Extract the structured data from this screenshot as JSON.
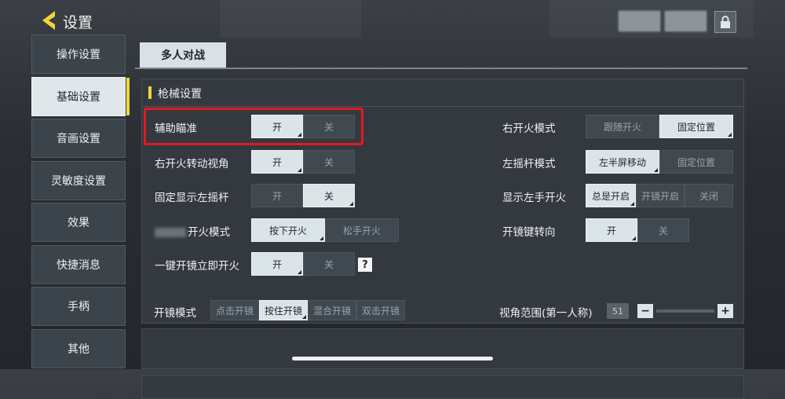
{
  "header": {
    "title": "设置"
  },
  "sidebar": {
    "items": [
      {
        "label": "操作设置"
      },
      {
        "label": "基础设置"
      },
      {
        "label": "音画设置"
      },
      {
        "label": "灵敏度设置"
      },
      {
        "label": "效果"
      },
      {
        "label": "快捷消息"
      },
      {
        "label": "手柄"
      },
      {
        "label": "其他"
      }
    ],
    "active_index": 1
  },
  "tabs": [
    {
      "label": "多人对战"
    }
  ],
  "weapon_section": {
    "title": "枪械设置",
    "left_rows": [
      {
        "label": "辅助瞄准",
        "options": [
          "开",
          "关"
        ],
        "selected": 0
      },
      {
        "label": "右开火转动视角",
        "options": [
          "开",
          "关"
        ],
        "selected": 0
      },
      {
        "label": "固定显示左摇杆",
        "options": [
          "开",
          "关"
        ],
        "selected": 1
      },
      {
        "label": "开火模式",
        "options": [
          "按下开火",
          "松手开火"
        ],
        "selected": 0
      },
      {
        "label": "一键开镜立即开火",
        "options": [
          "开",
          "关"
        ],
        "selected": 0,
        "help": "?"
      }
    ],
    "right_rows": [
      {
        "label": "右开火模式",
        "options": [
          "跟随开火",
          "固定位置"
        ],
        "selected": 1
      },
      {
        "label": "左摇杆模式",
        "options": [
          "左半屏移动",
          "固定位置"
        ],
        "selected": 0
      },
      {
        "label": "显示左手开火",
        "options": [
          "总是开启",
          "开镜开启",
          "关闭"
        ],
        "selected": 0
      },
      {
        "label": "开镜键转向",
        "options": [
          "开",
          "关"
        ],
        "selected": 0
      }
    ]
  },
  "scope_section": {
    "label": "开镜模式",
    "options": [
      "点击开镜",
      "按住开镜",
      "混合开镜",
      "双击开镜"
    ],
    "selected": 1,
    "fov_label": "视角范围(第一人称)",
    "fov_value": "51",
    "minus": "−",
    "plus": "+"
  },
  "colors": {
    "accent": "#f1d538",
    "highlight": "#e11b22"
  }
}
